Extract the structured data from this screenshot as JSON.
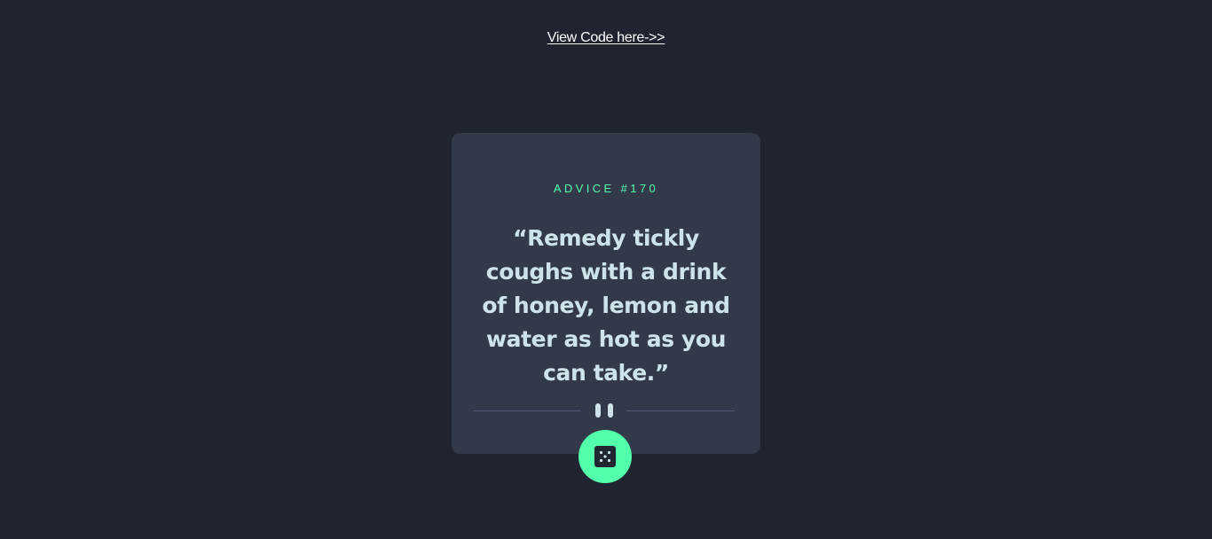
{
  "header": {
    "link_label": "View Code here->>"
  },
  "card": {
    "advice_id": "ADVICE #170",
    "quote": "“Remedy tickly coughs with a drink of honey, lemon and water as hot as you can take.”"
  },
  "icons": {
    "divider": "pause-divider-icon",
    "button": "dice-icon"
  },
  "colors": {
    "background": "#1f2430",
    "card": "#323a4a",
    "accent": "#53ffab",
    "quote_text": "#cee3e9",
    "divider_line": "#4f5d74"
  }
}
